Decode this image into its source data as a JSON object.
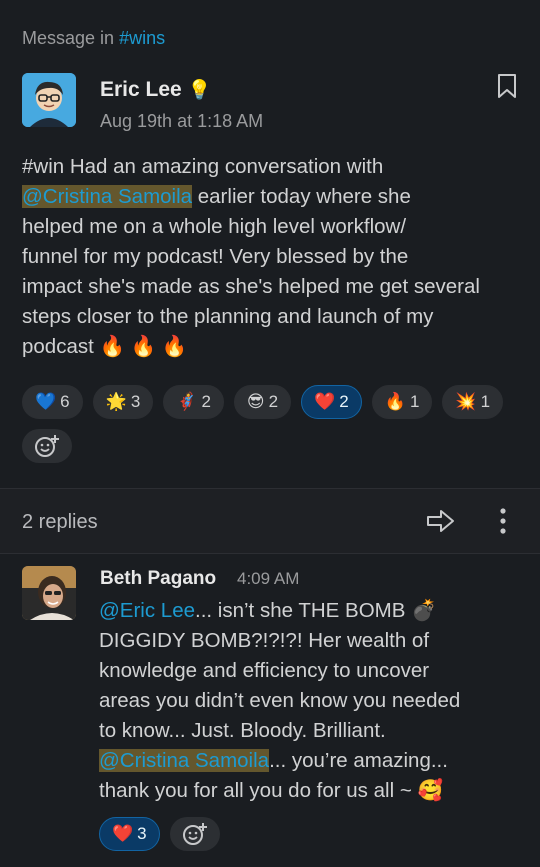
{
  "context": {
    "prefix": "Message in",
    "channel": "#wins"
  },
  "message": {
    "author": "Eric Lee",
    "author_emoji": "💡",
    "timestamp": "Aug 19th at 1:18 AM",
    "text_lines": [
      {
        "pre": "#win Had an amazing conversation with",
        "mention": "",
        "post": ""
      },
      {
        "pre": "",
        "mention": "@Cristina Samoila",
        "post": " earlier today where she"
      },
      {
        "pre": "helped me on a whole high level workflow/",
        "mention": "",
        "post": ""
      },
      {
        "pre": "funnel for my podcast! Very blessed by the",
        "mention": "",
        "post": ""
      },
      {
        "pre": "impact she's made as she's helped me get several",
        "mention": "",
        "post": ""
      },
      {
        "pre": "steps closer to the planning and launch of my",
        "mention": "",
        "post": ""
      },
      {
        "pre": "podcast 🔥 🔥 🔥",
        "mention": "",
        "post": ""
      }
    ],
    "reactions": [
      {
        "emoji": "💙",
        "count": "6",
        "active": false
      },
      {
        "emoji": "🌟",
        "count": "3",
        "active": false
      },
      {
        "emoji": "🦸",
        "count": "2",
        "active": false
      },
      {
        "emoji": "😎",
        "count": "2",
        "active": false
      },
      {
        "emoji": "❤️",
        "count": "2",
        "active": true
      },
      {
        "emoji": "🔥",
        "count": "1",
        "active": false
      },
      {
        "emoji": "💥",
        "count": "1",
        "active": false
      }
    ]
  },
  "thread": {
    "replies_label": "2 replies"
  },
  "reply": {
    "author": "Beth Pagano",
    "timestamp": "4:09 AM",
    "line1_mention": "@Eric Lee",
    "line1_post": "... isn’t she THE BOMB 💣",
    "line2": "DIGGIDY BOMB?!?!?!  Her wealth of",
    "line3": "knowledge and efficiency to uncover",
    "line4": "areas you didn’t even know you needed",
    "line5": "to know... Just. Bloody. Brilliant.",
    "line6_mention": "@Cristina Samoila",
    "line6_post": "... you’re amazing...",
    "line7": "thank you for all you do for us all  ~ 🥰",
    "reaction": {
      "emoji": "❤️",
      "count": "3",
      "active": true
    }
  },
  "colors": {
    "background": "#1a1d21",
    "link": "#1d9bd1",
    "mention_bg": "#5a5332",
    "active_reaction": "#0a3a66"
  }
}
